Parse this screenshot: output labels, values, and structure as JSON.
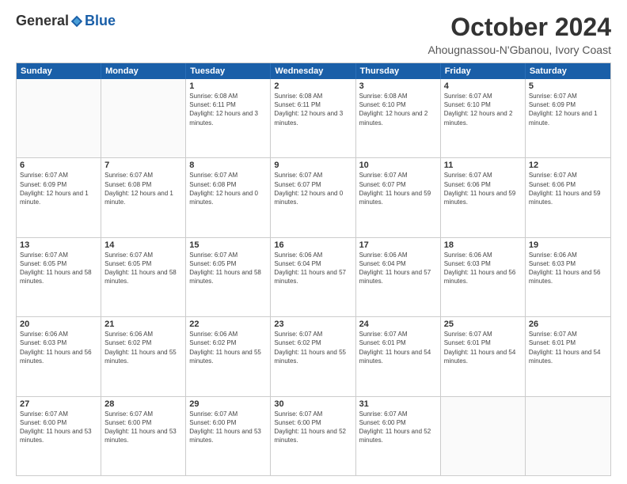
{
  "logo": {
    "general": "General",
    "blue": "Blue"
  },
  "header": {
    "title": "October 2024",
    "subtitle": "Ahougnassou-N'Gbanou, Ivory Coast"
  },
  "calendar": {
    "days_of_week": [
      "Sunday",
      "Monday",
      "Tuesday",
      "Wednesday",
      "Thursday",
      "Friday",
      "Saturday"
    ],
    "rows": [
      [
        {
          "day": "",
          "info": ""
        },
        {
          "day": "",
          "info": ""
        },
        {
          "day": "1",
          "info": "Sunrise: 6:08 AM\nSunset: 6:11 PM\nDaylight: 12 hours and 3 minutes."
        },
        {
          "day": "2",
          "info": "Sunrise: 6:08 AM\nSunset: 6:11 PM\nDaylight: 12 hours and 3 minutes."
        },
        {
          "day": "3",
          "info": "Sunrise: 6:08 AM\nSunset: 6:10 PM\nDaylight: 12 hours and 2 minutes."
        },
        {
          "day": "4",
          "info": "Sunrise: 6:07 AM\nSunset: 6:10 PM\nDaylight: 12 hours and 2 minutes."
        },
        {
          "day": "5",
          "info": "Sunrise: 6:07 AM\nSunset: 6:09 PM\nDaylight: 12 hours and 1 minute."
        }
      ],
      [
        {
          "day": "6",
          "info": "Sunrise: 6:07 AM\nSunset: 6:09 PM\nDaylight: 12 hours and 1 minute."
        },
        {
          "day": "7",
          "info": "Sunrise: 6:07 AM\nSunset: 6:08 PM\nDaylight: 12 hours and 1 minute."
        },
        {
          "day": "8",
          "info": "Sunrise: 6:07 AM\nSunset: 6:08 PM\nDaylight: 12 hours and 0 minutes."
        },
        {
          "day": "9",
          "info": "Sunrise: 6:07 AM\nSunset: 6:07 PM\nDaylight: 12 hours and 0 minutes."
        },
        {
          "day": "10",
          "info": "Sunrise: 6:07 AM\nSunset: 6:07 PM\nDaylight: 11 hours and 59 minutes."
        },
        {
          "day": "11",
          "info": "Sunrise: 6:07 AM\nSunset: 6:06 PM\nDaylight: 11 hours and 59 minutes."
        },
        {
          "day": "12",
          "info": "Sunrise: 6:07 AM\nSunset: 6:06 PM\nDaylight: 11 hours and 59 minutes."
        }
      ],
      [
        {
          "day": "13",
          "info": "Sunrise: 6:07 AM\nSunset: 6:05 PM\nDaylight: 11 hours and 58 minutes."
        },
        {
          "day": "14",
          "info": "Sunrise: 6:07 AM\nSunset: 6:05 PM\nDaylight: 11 hours and 58 minutes."
        },
        {
          "day": "15",
          "info": "Sunrise: 6:07 AM\nSunset: 6:05 PM\nDaylight: 11 hours and 58 minutes."
        },
        {
          "day": "16",
          "info": "Sunrise: 6:06 AM\nSunset: 6:04 PM\nDaylight: 11 hours and 57 minutes."
        },
        {
          "day": "17",
          "info": "Sunrise: 6:06 AM\nSunset: 6:04 PM\nDaylight: 11 hours and 57 minutes."
        },
        {
          "day": "18",
          "info": "Sunrise: 6:06 AM\nSunset: 6:03 PM\nDaylight: 11 hours and 56 minutes."
        },
        {
          "day": "19",
          "info": "Sunrise: 6:06 AM\nSunset: 6:03 PM\nDaylight: 11 hours and 56 minutes."
        }
      ],
      [
        {
          "day": "20",
          "info": "Sunrise: 6:06 AM\nSunset: 6:03 PM\nDaylight: 11 hours and 56 minutes."
        },
        {
          "day": "21",
          "info": "Sunrise: 6:06 AM\nSunset: 6:02 PM\nDaylight: 11 hours and 55 minutes."
        },
        {
          "day": "22",
          "info": "Sunrise: 6:06 AM\nSunset: 6:02 PM\nDaylight: 11 hours and 55 minutes."
        },
        {
          "day": "23",
          "info": "Sunrise: 6:07 AM\nSunset: 6:02 PM\nDaylight: 11 hours and 55 minutes."
        },
        {
          "day": "24",
          "info": "Sunrise: 6:07 AM\nSunset: 6:01 PM\nDaylight: 11 hours and 54 minutes."
        },
        {
          "day": "25",
          "info": "Sunrise: 6:07 AM\nSunset: 6:01 PM\nDaylight: 11 hours and 54 minutes."
        },
        {
          "day": "26",
          "info": "Sunrise: 6:07 AM\nSunset: 6:01 PM\nDaylight: 11 hours and 54 minutes."
        }
      ],
      [
        {
          "day": "27",
          "info": "Sunrise: 6:07 AM\nSunset: 6:00 PM\nDaylight: 11 hours and 53 minutes."
        },
        {
          "day": "28",
          "info": "Sunrise: 6:07 AM\nSunset: 6:00 PM\nDaylight: 11 hours and 53 minutes."
        },
        {
          "day": "29",
          "info": "Sunrise: 6:07 AM\nSunset: 6:00 PM\nDaylight: 11 hours and 53 minutes."
        },
        {
          "day": "30",
          "info": "Sunrise: 6:07 AM\nSunset: 6:00 PM\nDaylight: 11 hours and 52 minutes."
        },
        {
          "day": "31",
          "info": "Sunrise: 6:07 AM\nSunset: 6:00 PM\nDaylight: 11 hours and 52 minutes."
        },
        {
          "day": "",
          "info": ""
        },
        {
          "day": "",
          "info": ""
        }
      ]
    ]
  }
}
